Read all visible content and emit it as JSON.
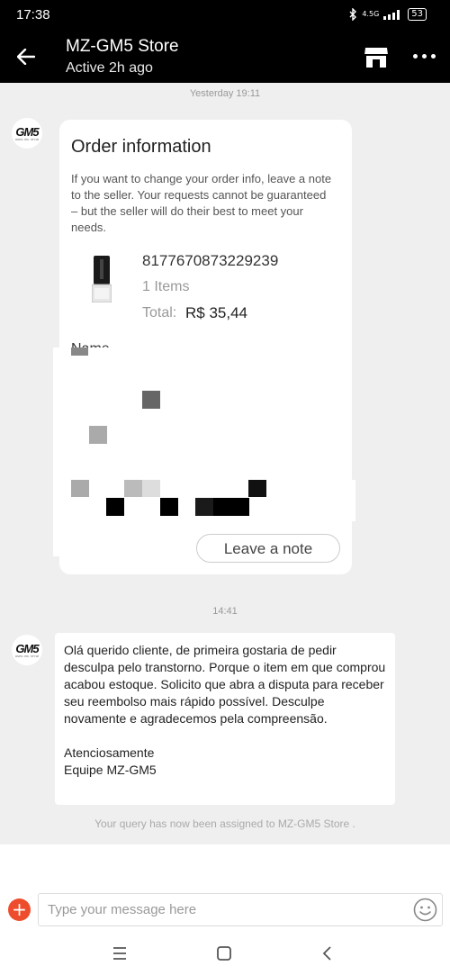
{
  "status_bar": {
    "time": "17:38",
    "network": "4.5G",
    "battery": "53"
  },
  "header": {
    "title": "MZ-GM5 Store",
    "subtitle": "Active 2h ago"
  },
  "chat": {
    "timestamp_1": "Yesterday 19:11",
    "timestamp_2": "14:41",
    "avatar_logo": "GM5",
    "avatar_sub": "OSHC. PIC. STYLE",
    "order_card": {
      "title": "Order information",
      "description": "If you want to change your order info, leave a note to the seller. Your requests cannot be guaranteed – but the seller will do their best to meet your needs.",
      "order_id": "8177670873229239",
      "items": "1 Items",
      "total_label": "Total:",
      "total_value": "R$ 35,44",
      "name_label": "Name",
      "leave_note_label": "Leave a note"
    },
    "message": {
      "body": "Olá querido cliente, de primeira gostaria de pedir desculpa pelo transtorno. Porque o item em que comprou acabou estoque. Solicito que abra a disputa para receber seu reembolso mais rápido possível. Desculpe novamente e agradecemos pela compreensão.",
      "signoff_1": "Atenciosamente",
      "signoff_2": "Equipe MZ-GM5"
    },
    "assignment_note": "Your query has now been assigned to MZ-GM5 Store ."
  },
  "composer": {
    "placeholder": "Type your message here"
  },
  "colors": {
    "accent": "#ee4d2d",
    "header_bg": "#000000",
    "chat_bg": "#efefef"
  }
}
